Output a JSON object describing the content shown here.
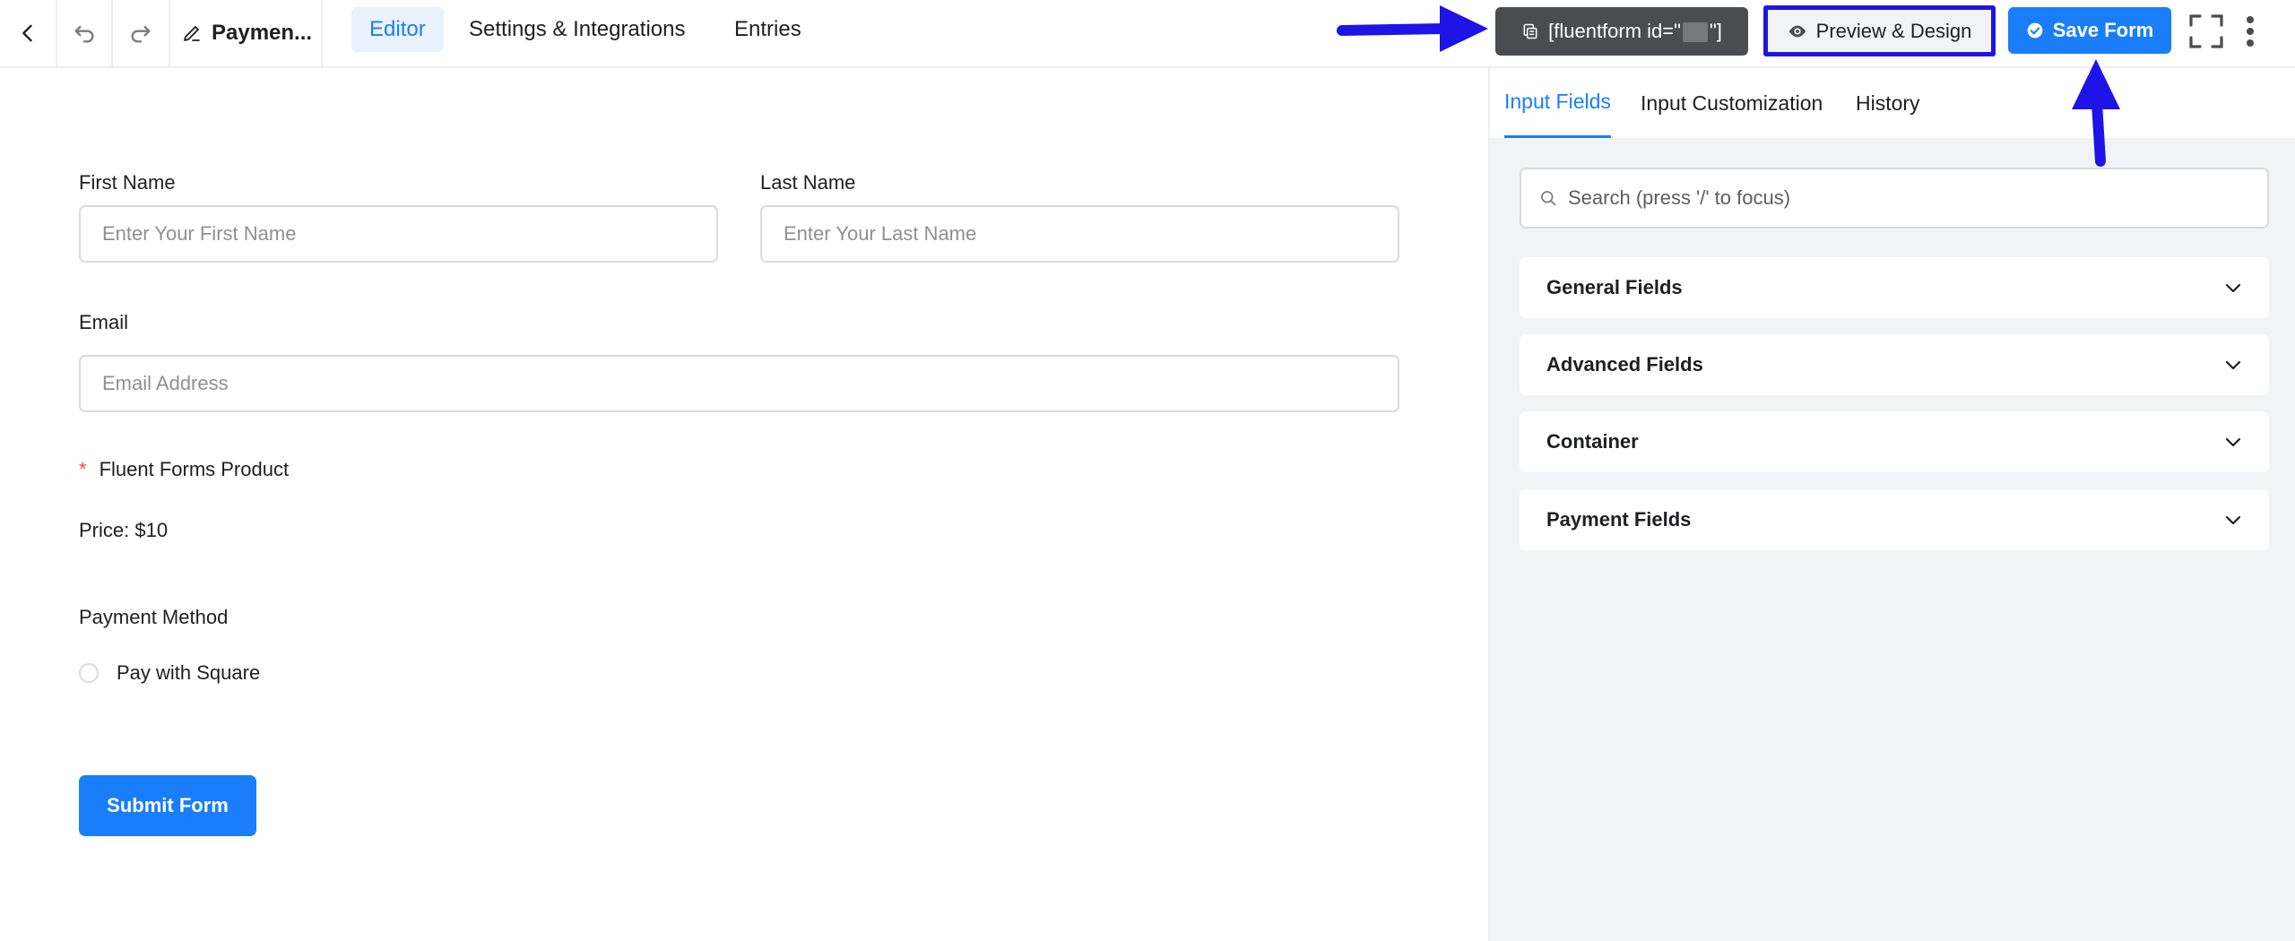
{
  "header": {
    "back_icon": "chevron-left-icon",
    "undo_icon": "undo-icon",
    "redo_icon": "redo-icon",
    "edit_icon": "pencil-icon",
    "form_title": "Paymen...",
    "tabs": [
      {
        "label": "Editor",
        "active": true
      },
      {
        "label": "Settings & Integrations",
        "active": false
      },
      {
        "label": "Entries",
        "active": false
      }
    ],
    "shortcode_prefix": "[fluentform id=\"",
    "shortcode_suffix": "\"]",
    "preview_label": "Preview & Design",
    "save_label": "Save Form",
    "fullscreen_icon": "fullscreen-icon",
    "more_icon": "more-vertical-icon"
  },
  "form": {
    "first_name": {
      "label": "First Name",
      "placeholder": "Enter Your First Name"
    },
    "last_name": {
      "label": "Last Name",
      "placeholder": "Enter Your Last Name"
    },
    "email": {
      "label": "Email",
      "placeholder": "Email Address"
    },
    "product": {
      "required_mark": "*",
      "label": "Fluent Forms Product",
      "price": "Price: $10"
    },
    "payment_method": {
      "label": "Payment Method",
      "option": "Pay with Square"
    },
    "submit_label": "Submit Form"
  },
  "panel": {
    "tabs": [
      {
        "label": "Input Fields",
        "active": true
      },
      {
        "label": "Input Customization",
        "active": false
      },
      {
        "label": "History",
        "active": false
      }
    ],
    "search_placeholder": "Search (press '/' to focus)",
    "sections": [
      "General Fields",
      "Advanced Fields",
      "Container",
      "Payment Fields"
    ]
  },
  "colors": {
    "accent": "#1a7efb",
    "annotation": "#1e14e6",
    "shortcode_bg": "#4b4c4d",
    "panel_bg": "#f2f3f5"
  }
}
